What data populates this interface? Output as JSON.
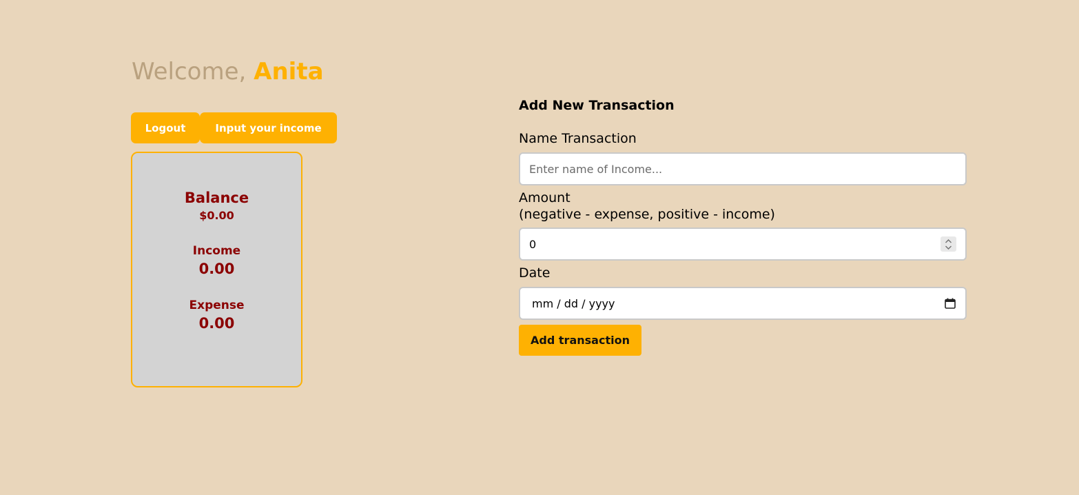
{
  "header": {
    "welcome_prefix": "Welcome, ",
    "user_name": "Anita"
  },
  "actions": {
    "logout_label": "Logout",
    "income_label": "Input your income"
  },
  "summary": {
    "balance_label": "Balance",
    "balance_value": "$0.00",
    "income_label": "Income",
    "income_value": "0.00",
    "expense_label": "Expense",
    "expense_value": "0.00"
  },
  "form": {
    "title": "Add New Transaction",
    "name_label": "Name Transaction",
    "name_placeholder": "Enter name of Income...",
    "amount_label": "Amount",
    "amount_hint": "(negative - expense, positive - income)",
    "amount_value": "0",
    "date_label": "Date",
    "date_placeholder": "mm / dd / yyyy",
    "submit_label": "Add transaction"
  },
  "icons": {
    "amount_stepper": "spin-stepper-icon",
    "date_picker": "calendar-icon"
  },
  "colors": {
    "background": "#e9d6bb",
    "accent": "#feb102",
    "welcome_text": "#b9a17f",
    "card_background": "#d3d3d3",
    "card_text": "#8b0000"
  }
}
